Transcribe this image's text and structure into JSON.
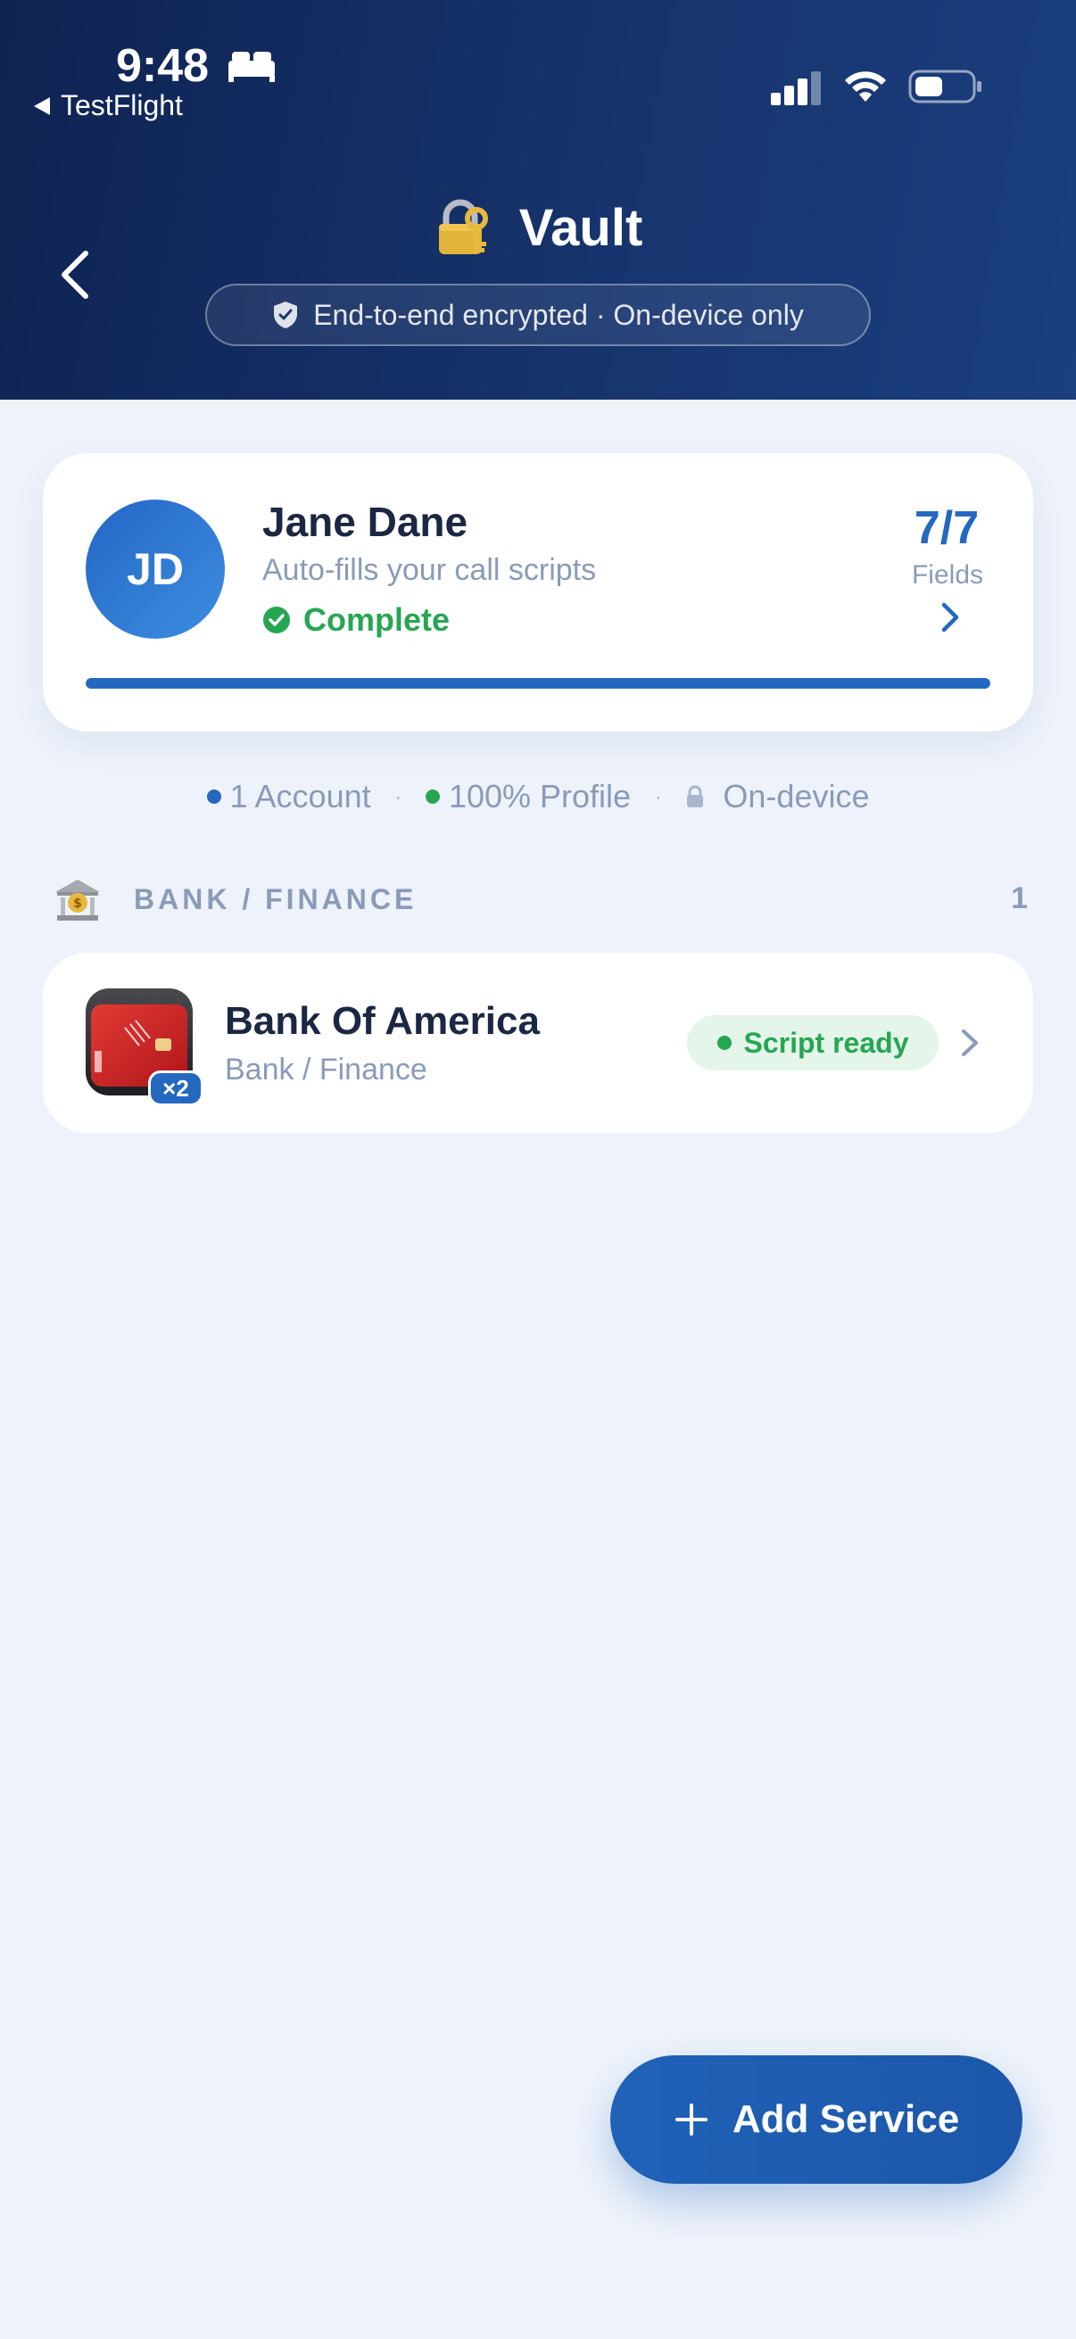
{
  "status_bar": {
    "time": "9:48",
    "back_app": "TestFlight",
    "icons": [
      "bed-icon",
      "signal-icon",
      "wifi-icon",
      "battery-icon"
    ]
  },
  "header": {
    "title": "Vault",
    "title_icon": "lock-with-key-icon",
    "encryption_label": "End-to-end encrypted · On-device only",
    "background": "#13306a"
  },
  "profile": {
    "initials": "JD",
    "name": "Jane Dane",
    "subtitle": "Auto-fills your call scripts",
    "status": "Complete",
    "fields_count": "7/7",
    "fields_label": "Fields",
    "progress": 1.0,
    "accent": "#2468c0",
    "status_color": "#27a652"
  },
  "stats": {
    "accounts": "1 Account",
    "profile": "100% Profile",
    "storage": "On-device"
  },
  "section": {
    "title": "BANK / FINANCE",
    "count": "1",
    "icon": "bank-icon"
  },
  "services": [
    {
      "name": "Bank Of America",
      "category": "Bank / Finance",
      "badge": "×2",
      "status": "Script ready"
    }
  ],
  "fab": {
    "label": "Add Service"
  }
}
